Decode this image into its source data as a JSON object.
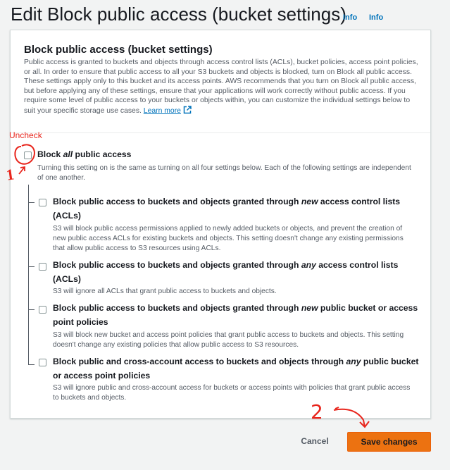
{
  "header": {
    "title": "Edit Block public access (bucket settings)",
    "info_links": [
      "Info",
      "Info"
    ]
  },
  "section": {
    "title": "Block public access (bucket settings)",
    "description": "Public access is granted to buckets and objects through access control lists (ACLs), bucket policies, access point policies, or all. In order to ensure that public access to all your S3 buckets and objects is blocked, turn on Block all public access. These settings apply only to this bucket and its access points. AWS recommends that you turn on Block all public access, but before applying any of these settings, ensure that your applications will work correctly without public access. If you require some level of public access to your buckets or objects within, you can customize the individual settings below to suit your specific storage use cases.",
    "learn_more": "Learn more"
  },
  "block_all": {
    "title_pre": "Block ",
    "title_em": "all",
    "title_post": " public access",
    "description": "Turning this setting on is the same as turning on all four settings below. Each of the following settings are independent of one another.",
    "checked": false
  },
  "options": [
    {
      "title_pre": "Block public access to buckets and objects granted through ",
      "title_em": "new",
      "title_post": " access control lists (ACLs)",
      "description": "S3 will block public access permissions applied to newly added buckets or objects, and prevent the creation of new public access ACLs for existing buckets and objects. This setting doesn't change any existing permissions that allow public access to S3 resources using ACLs.",
      "checked": false
    },
    {
      "title_pre": "Block public access to buckets and objects granted through ",
      "title_em": "any",
      "title_post": " access control lists (ACLs)",
      "description": "S3 will ignore all ACLs that grant public access to buckets and objects.",
      "checked": false
    },
    {
      "title_pre": "Block public access to buckets and objects granted through ",
      "title_em": "new",
      "title_post": " public bucket or access point policies",
      "description": "S3 will block new bucket and access point policies that grant public access to buckets and objects. This setting doesn't change any existing policies that allow public access to S3 resources.",
      "checked": false
    },
    {
      "title_pre": "Block public and cross-account access to buckets and objects through ",
      "title_em": "any",
      "title_post": " public bucket or access point policies",
      "description": "S3 will ignore public and cross-account access for buckets or access points with policies that grant public access to buckets and objects.",
      "checked": false
    }
  ],
  "footer": {
    "cancel_label": "Cancel",
    "save_label": "Save changes"
  },
  "annotations": {
    "uncheck_text": "Uncheck",
    "step1": "1",
    "step2": "2",
    "color": "#e8251c"
  }
}
